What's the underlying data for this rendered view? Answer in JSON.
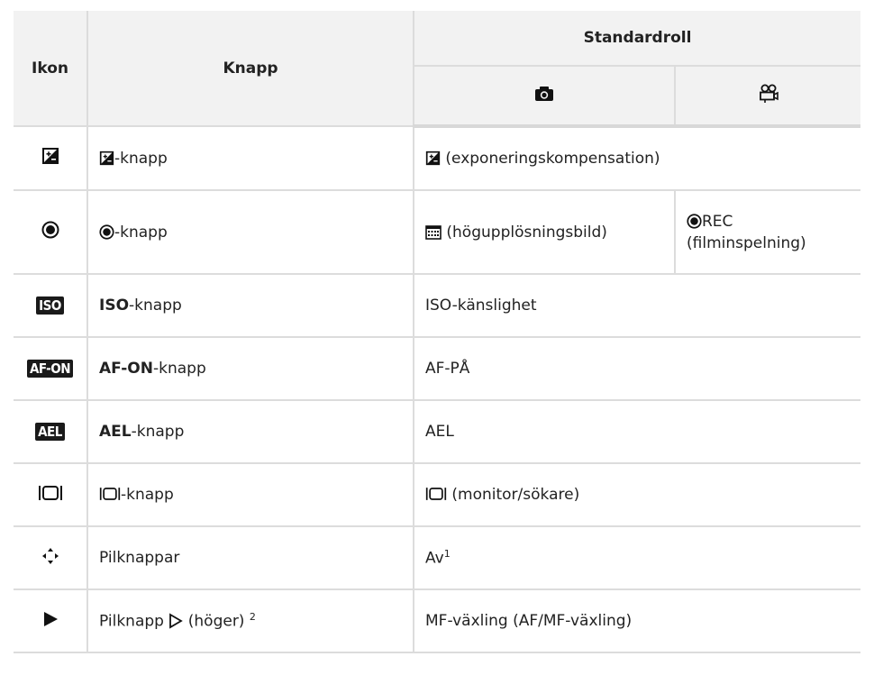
{
  "header": {
    "ikon": "Ikon",
    "knapp": "Knapp",
    "standardroll": "Standardroll",
    "sub_photo_icon": "camera-icon",
    "sub_movie_icon": "movie-camera-icon"
  },
  "rows": [
    {
      "icon": "exposure-compensation-icon",
      "button_text": "-knapp",
      "role_text": " (exponeringskompensation)"
    },
    {
      "icon": "record-icon",
      "button_text": "-knapp",
      "role_photo": " (högupplösningsbild)",
      "role_movie_1": "REC",
      "role_movie_2": "(filminspelning)"
    },
    {
      "icon_text": "ISO",
      "button_bold": "ISO",
      "button_text": "-knapp",
      "role_text": "ISO-känslighet"
    },
    {
      "icon_text": "AF-ON",
      "button_bold": "AF-ON",
      "button_text": "-knapp",
      "role_text": "AF-PÅ"
    },
    {
      "icon_text": "AEL",
      "button_bold": "AEL",
      "button_text": "-knapp",
      "role_text": "AEL"
    },
    {
      "icon": "monitor-viewfinder-icon",
      "button_text": "-knapp",
      "role_text": " (monitor/sökare)"
    },
    {
      "icon": "arrow-pad-icon",
      "button_text": "Pilknappar",
      "role_text": "Av",
      "role_sup": "1"
    },
    {
      "icon": "play-icon",
      "button_text": "Pilknapp ",
      "button_text_2": " (höger) ",
      "button_sup": "2",
      "role_text": "MF-växling (AF/MF-växling)"
    }
  ]
}
